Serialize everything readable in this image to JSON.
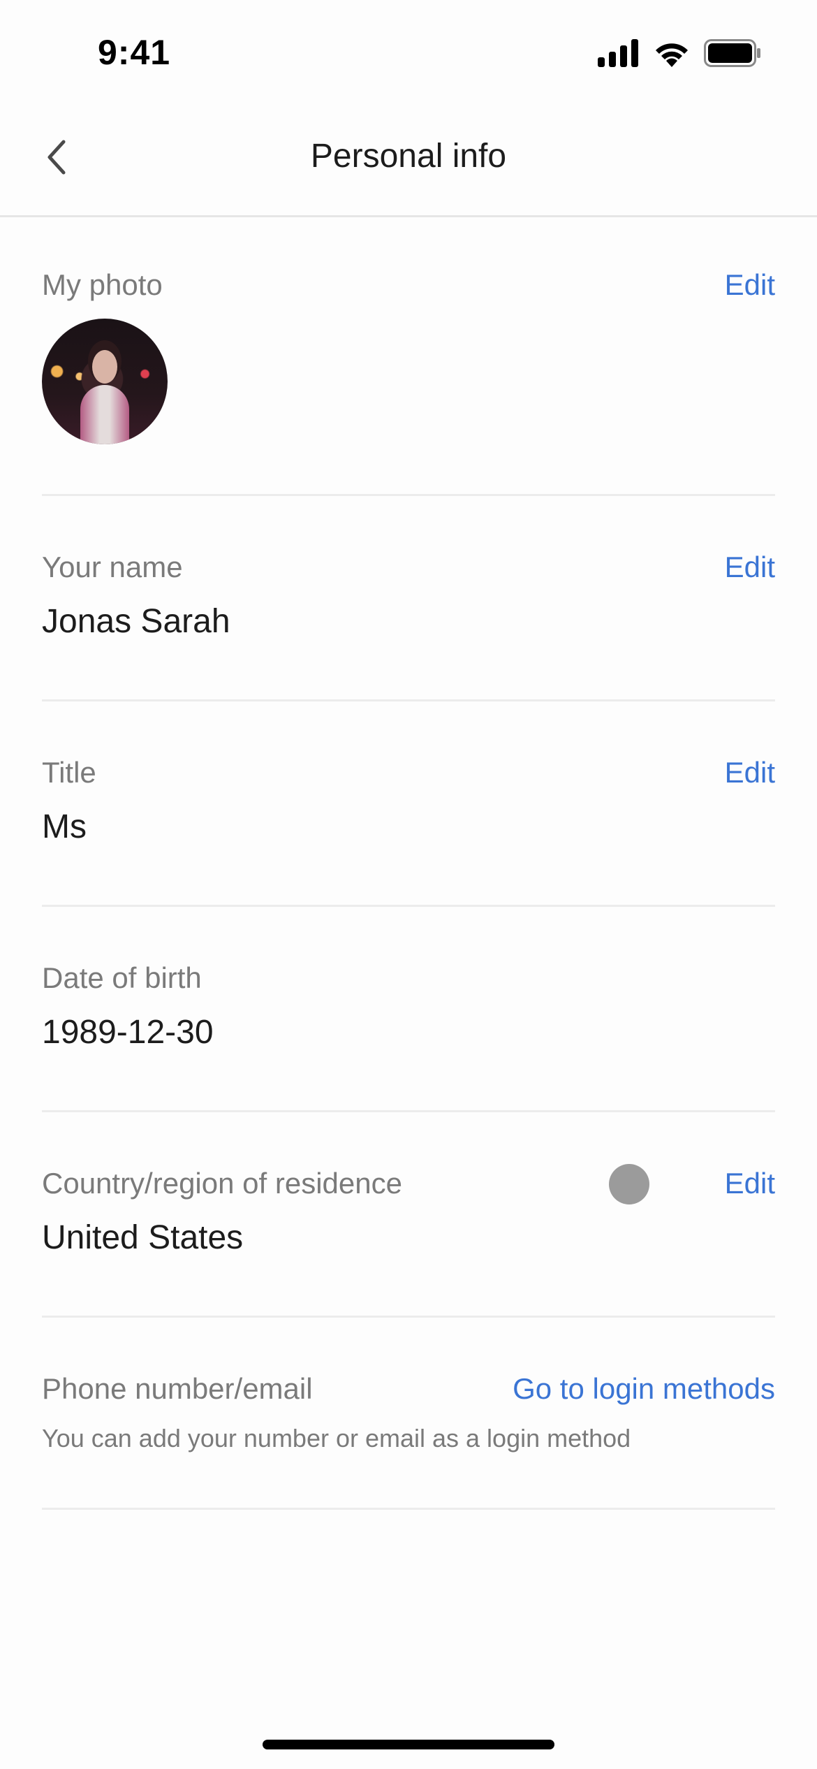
{
  "status_bar": {
    "time": "9:41",
    "icons": [
      "signal-icon",
      "wifi-icon",
      "battery-icon"
    ]
  },
  "nav": {
    "title": "Personal info",
    "back_icon": "chevron-left-icon"
  },
  "colors": {
    "accent": "#3a74d4",
    "label": "#7a7a7a",
    "value": "#1c1c1c",
    "divider": "#ececec"
  },
  "rows": {
    "photo": {
      "label": "My photo",
      "action": "Edit"
    },
    "name": {
      "label": "Your name",
      "value": "Jonas Sarah",
      "action": "Edit"
    },
    "title": {
      "label": "Title",
      "value": "Ms",
      "action": "Edit"
    },
    "dob": {
      "label": "Date of birth",
      "value": "1989-12-30"
    },
    "country": {
      "label": "Country/region of residence",
      "value": "United States",
      "action": "Edit"
    },
    "contact": {
      "label": "Phone number/email",
      "action": "Go to login methods",
      "note": "You can add your number or email as a login method"
    }
  }
}
